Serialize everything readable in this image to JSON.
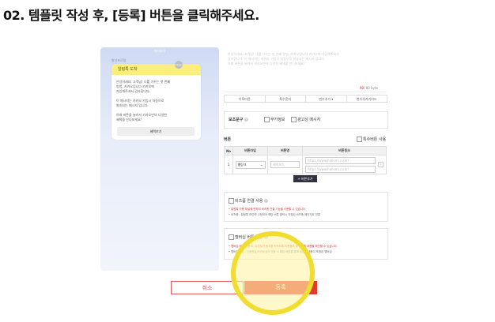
{
  "heading": "02. 템플릿 작성 후, [등록] 버튼을 클릭해주세요.",
  "preview": {
    "top_label": "미리보기",
    "sender": "발신프로필",
    "bubble_header": "알림톡 도착",
    "kakao_badge": "kakao",
    "paragraph1": "안녕하세요, 고객님! 나를 가꾸는 첫 번째\n방법, 카카오입니다 카카오에\n가입해주셔서 감사합니다.",
    "paragraph2": "이 메시지는 카카오 가입시 자동으로\n발송되는 메시지 입니다.",
    "paragraph3": "아래 버튼을 눌러서 카카오만의 다양한\n혜택을 만나보세요!",
    "button_label": "혜택보기"
  },
  "editor": {
    "body_text": "안녕하세요, 고객님! 나를 가꾸는 첫 번째 방법, 카카오입니다 카카오에 가입해주셔서\n감사합니다. 이 메시지는 카카오 가입시 자동으로 발송되는 메시지 입니다.\n아래 버튼을 눌러서 카카오만의 다양한 혜택을 만나보세요!",
    "byte_count": "90",
    "byte_limit": "/ 90 byte",
    "variables": [
      "이모티콘",
      "특수문자",
      "변수추가",
      "변수추가가이드"
    ]
  },
  "supplement": {
    "label": "보조문구",
    "option1": "부가정보",
    "option2": "광고성 메시지"
  },
  "buttons_section": {
    "label": "버튼",
    "special_label": "특수버튼 사용",
    "headers": [
      "No",
      "버튼타입",
      "버튼명",
      "버튼링크"
    ],
    "rows": [
      {
        "no": "1",
        "type": "웹링크",
        "name_placeholder": "혜택보기",
        "link1_placeholder": "https://www.hallomi.co.kr/",
        "link2_placeholder": "https://www.hallomi.co.kr/"
      }
    ],
    "add_label": "+ 버튼추가"
  },
  "bizform": {
    "label": "비즈폼 연결 사용",
    "note_red": "• 알림톡 이용 채널에 한하여 비즈폼 연결 기능을 사용할 수 있습니다.",
    "note_grey": "• 비즈폼 : 알림톡 하단에 고정되어 해당 버튼 클릭시 지정된 비즈폼 페이지로 연결"
  },
  "membership": {
    "label": "멤버십 버튼 사용",
    "note_red": "• 멤버십 버튼 사용 시, 수신자가 동의한 카카오톡 이용정보 및 알림톡 내용을 확인할 수 있습니다.",
    "note_grey": "• 멤버십 버튼 : 인증번호/카카오싱크 연동 시 해당 버튼을 통해 알림톡 내용이 포함된 멤버십"
  },
  "actions": {
    "cancel": "취소",
    "register": "등록"
  },
  "colors": {
    "accent_red": "#e23a2e",
    "highlight_yellow": "#f1dd2f",
    "bubble_yellow": "#fbee7d"
  }
}
